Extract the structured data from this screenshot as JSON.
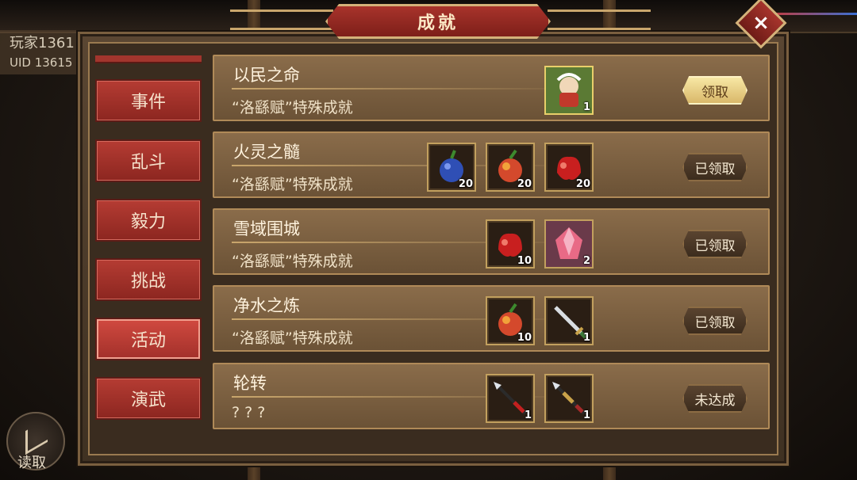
{
  "player": {
    "name": "玩家1361",
    "uid": "UID  13615"
  },
  "window": {
    "title": "成就",
    "close_glyph": "×"
  },
  "read_button": {
    "label": "读取",
    "icon": "read-icon"
  },
  "tabs": [
    {
      "label": "事件",
      "active": false
    },
    {
      "label": "乱斗",
      "active": false
    },
    {
      "label": "毅力",
      "active": false
    },
    {
      "label": "挑战",
      "active": false
    },
    {
      "label": "活动",
      "active": true
    },
    {
      "label": "演武",
      "active": false
    }
  ],
  "achievements": [
    {
      "title": "以民之命",
      "desc": "“洛繇赋”特殊成就",
      "rewards": [
        {
          "icon": "npc-avatar-icon",
          "count": "1"
        }
      ],
      "action": "领取",
      "state": "claimable"
    },
    {
      "title": "火灵之髓",
      "desc": "“洛繇赋”特殊成就",
      "rewards": [
        {
          "icon": "blue-fruit-icon",
          "count": "20"
        },
        {
          "icon": "orange-fruit-icon",
          "count": "20"
        },
        {
          "icon": "red-fruit-icon",
          "count": "20"
        }
      ],
      "action": "已领取",
      "state": "claimed"
    },
    {
      "title": "雪域围城",
      "desc": "“洛繇赋”特殊成就",
      "rewards": [
        {
          "icon": "red-fruit-icon",
          "count": "10"
        },
        {
          "icon": "pink-crystal-icon",
          "count": "2"
        }
      ],
      "action": "已领取",
      "state": "claimed"
    },
    {
      "title": "净水之炼",
      "desc": "“洛繇赋”特殊成就",
      "rewards": [
        {
          "icon": "orange-fruit-icon",
          "count": "10"
        },
        {
          "icon": "sword-icon",
          "count": "1"
        }
      ],
      "action": "已领取",
      "state": "claimed"
    },
    {
      "title": "轮转",
      "desc": "? ? ?",
      "rewards": [
        {
          "icon": "spear-red-icon",
          "count": "1"
        },
        {
          "icon": "spear-gold-icon",
          "count": "1"
        }
      ],
      "action": "未达成",
      "state": "locked"
    }
  ],
  "colors": {
    "tab_red": "#b53c33",
    "row_brown": "#7b5f40",
    "gold_border": "#c2a05e",
    "claim_button": "#f0dc94"
  }
}
